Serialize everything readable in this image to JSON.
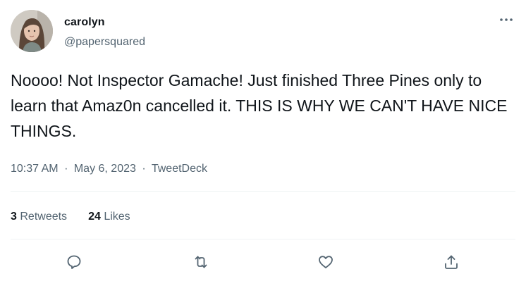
{
  "tweet": {
    "author": {
      "display_name": "carolyn",
      "handle": "@papersquared"
    },
    "text": "Noooo! Not Inspector Gamache! Just finished Three Pines only to learn that Amaz0n cancelled it. THIS IS WHY WE CAN'T HAVE NICE THINGS.",
    "meta": {
      "time": "10:37 AM",
      "separator": "·",
      "date": "May 6, 2023",
      "source": "TweetDeck"
    },
    "stats": {
      "retweets_count": "3",
      "retweets_label": "Retweets",
      "likes_count": "24",
      "likes_label": "Likes"
    },
    "actions": [
      {
        "icon": "reply-icon"
      },
      {
        "icon": "retweet-icon"
      },
      {
        "icon": "like-icon"
      },
      {
        "icon": "share-icon"
      }
    ]
  },
  "colors": {
    "text_primary": "#0f1419",
    "text_secondary": "#536471",
    "divider": "#eff3f4"
  }
}
